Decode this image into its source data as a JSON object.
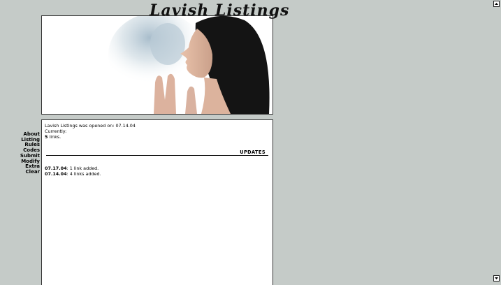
{
  "site": {
    "title": "Lavish Listings"
  },
  "nav": {
    "items": [
      "About",
      "Listing",
      "Rules",
      "Codes",
      "Submit",
      "Modify",
      "Extra",
      "Clear"
    ]
  },
  "intro": {
    "opened_text": "Lavish Listings was opened on: 07.14.04",
    "currently_label": "Currently:",
    "link_count": "5",
    "link_count_suffix": " links."
  },
  "updates": {
    "heading": "UPDATES",
    "entries": [
      {
        "date": "07.17.04",
        "text": ": 1 link added."
      },
      {
        "date": "07.14.04",
        "text": ": 4 links added."
      }
    ]
  },
  "icons": {
    "scroll_up": "arrow-up-icon",
    "scroll_down": "arrow-down-icon"
  }
}
